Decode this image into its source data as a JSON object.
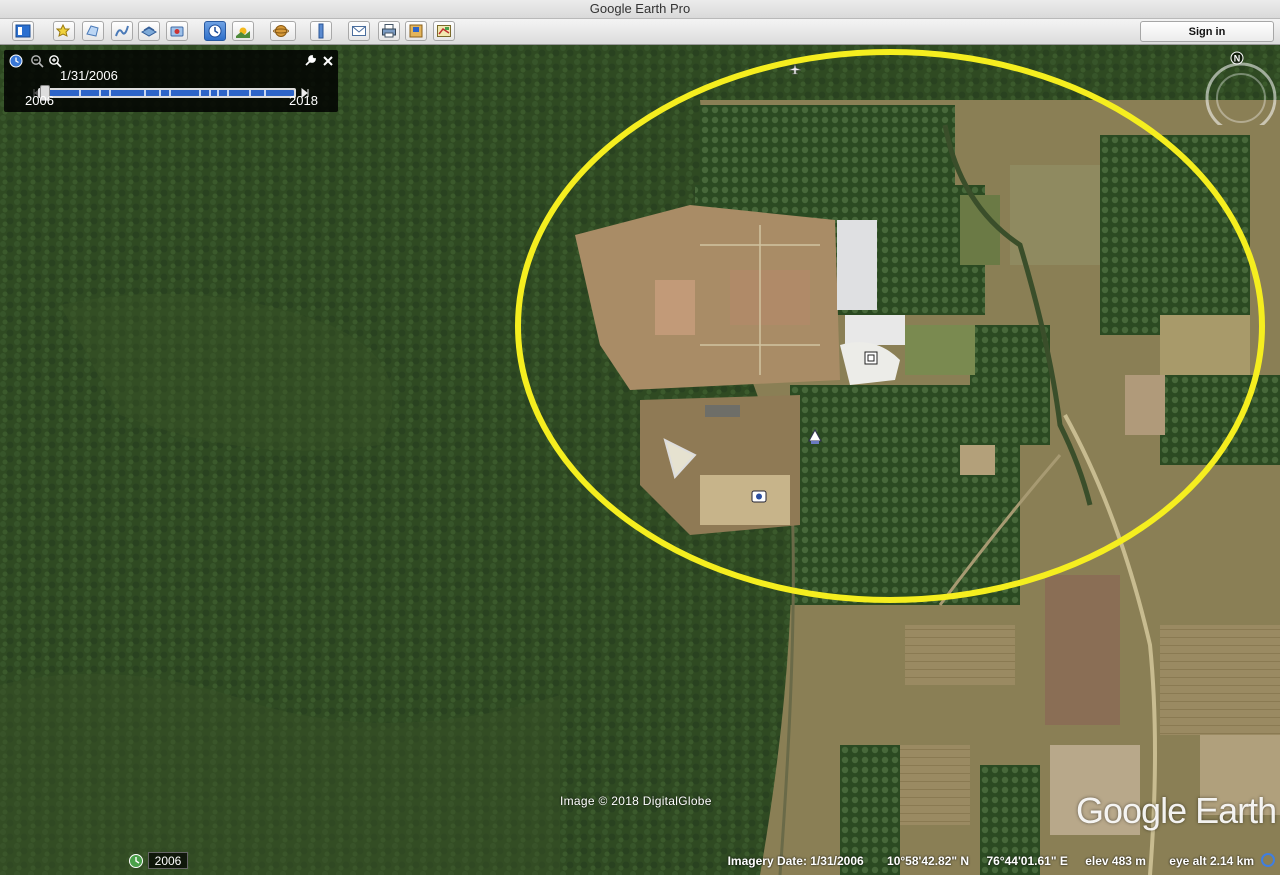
{
  "window": {
    "title": "Google Earth Pro"
  },
  "toolbar": {
    "buttons": [
      {
        "icon": "sidebar-icon"
      },
      {
        "icon": "placemark-icon"
      },
      {
        "icon": "polygon-icon"
      },
      {
        "icon": "path-icon"
      },
      {
        "icon": "overlay-icon"
      },
      {
        "icon": "record-tour-icon"
      },
      {
        "icon": "historical-imagery-icon"
      },
      {
        "icon": "sunlight-icon"
      },
      {
        "icon": "planets-icon"
      },
      {
        "icon": "ruler-icon"
      },
      {
        "icon": "email-icon"
      },
      {
        "icon": "print-icon"
      },
      {
        "icon": "save-image-icon"
      },
      {
        "icon": "view-in-maps-icon"
      }
    ],
    "sign_in_label": "Sign in"
  },
  "time_slider": {
    "current_date": "1/31/2006",
    "start_year": "2006",
    "end_year": "2018",
    "position_fraction": 0.0
  },
  "compass": {
    "north_label": "N"
  },
  "overlay": {
    "highlight_color": "#f5ee1f",
    "image_credit": "Image © 2018 DigitalGlobe",
    "logo_text": "Google Earth"
  },
  "status_bar": {
    "history_year": "2006",
    "imagery_date": "Imagery Date: 1/31/2006",
    "latitude": "10°58'42.82\" N",
    "longitude": "76°44'01.61\" E",
    "elevation": "elev  483 m",
    "eye_altitude": "eye alt  2.14 km"
  },
  "colors": {
    "forest": "#2f4a22",
    "plantation": "#3a5a2a",
    "cleared_land": "#b59a72",
    "accent_blue": "#2d64c8"
  }
}
